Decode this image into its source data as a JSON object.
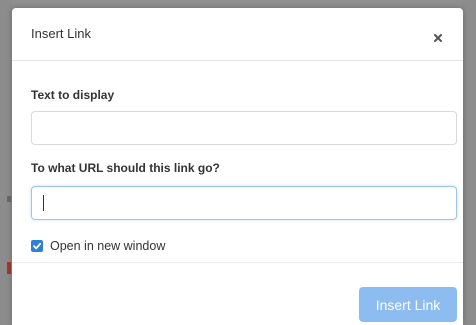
{
  "modal": {
    "title": "Insert Link",
    "close_icon": "close-icon"
  },
  "fields": {
    "text_label": "Text to display",
    "text_value": "",
    "url_label": "To what URL should this link go?",
    "url_value": ""
  },
  "options": {
    "new_window_label": "Open in new window",
    "new_window_checked": true
  },
  "footer": {
    "insert_button_label": "Insert Link"
  },
  "colors": {
    "accent": "#2f7fd8",
    "button_disabled": "#8dbcf0",
    "overlay": "#8f8f8f"
  }
}
